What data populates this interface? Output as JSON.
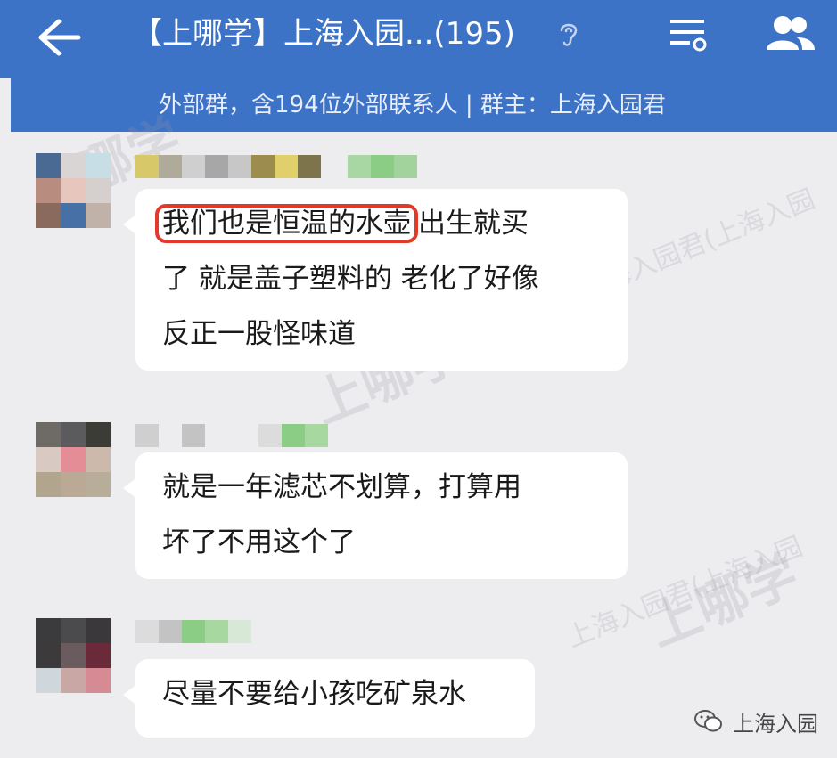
{
  "header": {
    "title": "【上哪学】上海入园...(195)",
    "subtitle": "外部群，含194位外部联系人 | 群主：上海入园君",
    "colors": {
      "bar": "#3d73c6",
      "text": "#ffffff"
    },
    "icons": [
      "back-arrow-icon",
      "ear-icon",
      "menu-icon",
      "members-icon"
    ]
  },
  "messages": [
    {
      "lines": [
        "我们也是恒温的水壶",
        "出生就买",
        "了 就是盖子塑料的 老化了好像",
        "反正一股怪味道"
      ],
      "highlight": "我们也是恒温的水壶"
    },
    {
      "lines": [
        "就是一年滤芯不划算，打算用",
        "坏了不用这个了"
      ]
    },
    {
      "lines": [
        "尽量不要给小孩吃矿泉水"
      ]
    }
  ],
  "watermark": {
    "brand": "上哪学",
    "group": "上海入园君(上海入园",
    "footer_brand": "上海入园"
  },
  "colors": {
    "highlight_border": "#e03a2a",
    "chat_bg": "#ededf0",
    "bubble": "#ffffff"
  }
}
